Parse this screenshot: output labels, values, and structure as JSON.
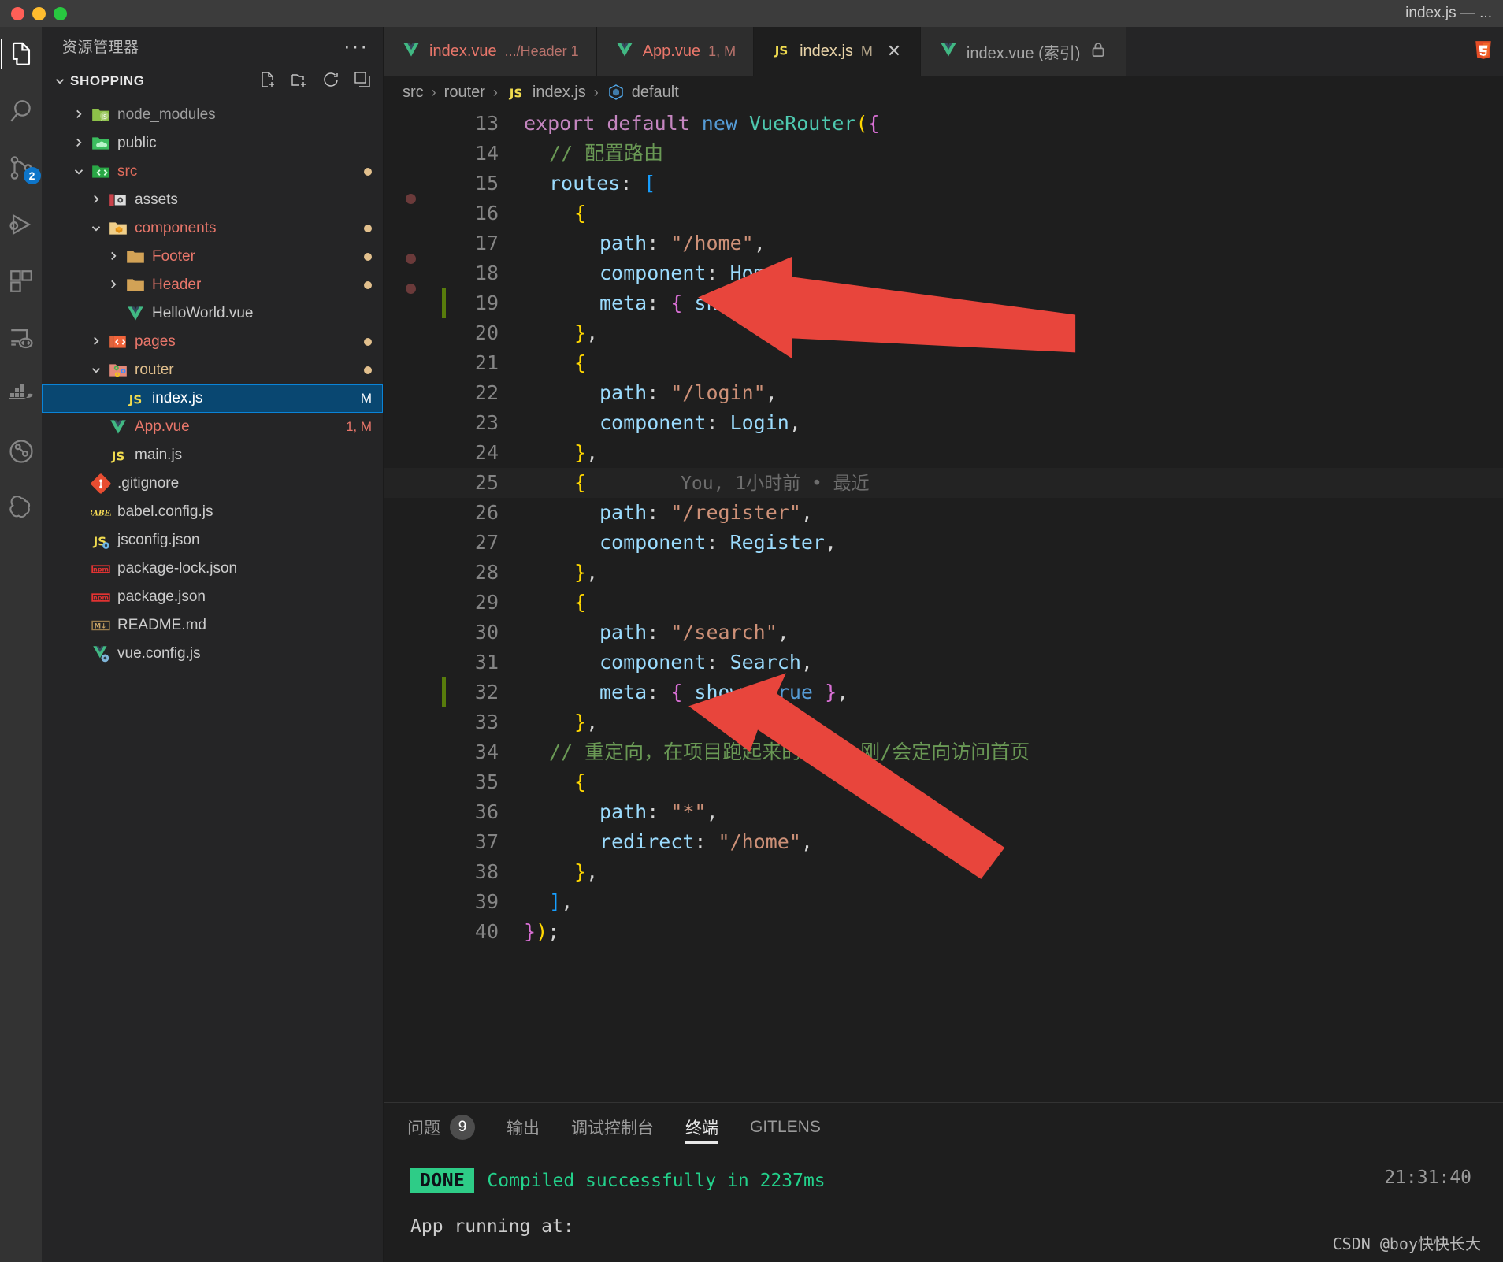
{
  "window": {
    "title": "index.js — ...",
    "traffic_lights": [
      "close",
      "minimize",
      "zoom"
    ]
  },
  "activitybar": {
    "items": [
      {
        "name": "explorer",
        "icon": "files-icon",
        "active": true,
        "badge": ""
      },
      {
        "name": "search",
        "icon": "search-icon",
        "active": false,
        "badge": ""
      },
      {
        "name": "source-control",
        "icon": "source-control-icon",
        "active": false,
        "badge": "2"
      },
      {
        "name": "run-and-debug",
        "icon": "run-debug-icon",
        "active": false,
        "badge": ""
      },
      {
        "name": "extensions",
        "icon": "extensions-icon",
        "active": false,
        "badge": ""
      },
      {
        "name": "remote-explorer",
        "icon": "remote-explorer-icon",
        "active": false,
        "badge": ""
      },
      {
        "name": "docker",
        "icon": "docker-icon",
        "active": false,
        "badge": ""
      },
      {
        "name": "gitlens",
        "icon": "gitlens-icon",
        "active": false,
        "badge": ""
      },
      {
        "name": "chatgpt",
        "icon": "chatgpt-icon",
        "active": false,
        "badge": ""
      }
    ]
  },
  "sidebar": {
    "title": "资源管理器",
    "more_label": "···",
    "section": {
      "name": "SHOPPING",
      "expanded": true,
      "actions": [
        "new-file",
        "new-folder",
        "refresh",
        "collapse-all"
      ]
    },
    "tree": [
      {
        "label": "node_modules",
        "icon": "folder-node",
        "indent": 1,
        "twisty": "collapsed",
        "color": "#a0a0a0",
        "meta": "",
        "dot": false,
        "selected": false
      },
      {
        "label": "public",
        "icon": "folder-public",
        "indent": 1,
        "twisty": "collapsed",
        "color": "#cccccc",
        "meta": "",
        "dot": false,
        "selected": false
      },
      {
        "label": "src",
        "icon": "folder-src",
        "indent": 1,
        "twisty": "expanded",
        "color": "#e06c5c",
        "meta": "",
        "dot": true,
        "selected": false
      },
      {
        "label": "assets",
        "icon": "folder-assets",
        "indent": 2,
        "twisty": "collapsed",
        "color": "#cccccc",
        "meta": "",
        "dot": false,
        "selected": false
      },
      {
        "label": "components",
        "icon": "folder-components",
        "indent": 2,
        "twisty": "expanded",
        "color": "#e8766a",
        "meta": "",
        "dot": true,
        "selected": false
      },
      {
        "label": "Footer",
        "icon": "folder-plain",
        "indent": 3,
        "twisty": "collapsed",
        "color": "#e8766a",
        "meta": "",
        "dot": true,
        "selected": false
      },
      {
        "label": "Header",
        "icon": "folder-plain",
        "indent": 3,
        "twisty": "collapsed",
        "color": "#e8766a",
        "meta": "",
        "dot": true,
        "selected": false
      },
      {
        "label": "HelloWorld.vue",
        "icon": "vue-icon",
        "indent": 3,
        "twisty": "none",
        "color": "#cccccc",
        "meta": "",
        "dot": false,
        "selected": false
      },
      {
        "label": "pages",
        "icon": "folder-pages",
        "indent": 2,
        "twisty": "collapsed",
        "color": "#e8766a",
        "meta": "",
        "dot": true,
        "selected": false
      },
      {
        "label": "router",
        "icon": "folder-router",
        "indent": 2,
        "twisty": "expanded",
        "color": "#e2c08d",
        "meta": "",
        "dot": true,
        "selected": false
      },
      {
        "label": "index.js",
        "icon": "js-icon",
        "indent": 3,
        "twisty": "none",
        "color": "#ffffff",
        "meta": "M",
        "dot": false,
        "selected": true
      },
      {
        "label": "App.vue",
        "icon": "vue-icon",
        "indent": 2,
        "twisty": "none",
        "color": "#e8766a",
        "meta": "1, M",
        "dot": false,
        "selected": false
      },
      {
        "label": "main.js",
        "icon": "js-icon",
        "indent": 2,
        "twisty": "none",
        "color": "#cccccc",
        "meta": "",
        "dot": false,
        "selected": false
      },
      {
        "label": ".gitignore",
        "icon": "git-icon",
        "indent": 1,
        "twisty": "none",
        "color": "#cccccc",
        "meta": "",
        "dot": false,
        "selected": false
      },
      {
        "label": "babel.config.js",
        "icon": "babel-icon",
        "indent": 1,
        "twisty": "none",
        "color": "#cccccc",
        "meta": "",
        "dot": false,
        "selected": false
      },
      {
        "label": "jsconfig.json",
        "icon": "jsconfig-icon",
        "indent": 1,
        "twisty": "none",
        "color": "#cccccc",
        "meta": "",
        "dot": false,
        "selected": false
      },
      {
        "label": "package-lock.json",
        "icon": "npm-icon",
        "indent": 1,
        "twisty": "none",
        "color": "#cccccc",
        "meta": "",
        "dot": false,
        "selected": false
      },
      {
        "label": "package.json",
        "icon": "npm-icon",
        "indent": 1,
        "twisty": "none",
        "color": "#cccccc",
        "meta": "",
        "dot": false,
        "selected": false
      },
      {
        "label": "README.md",
        "icon": "markdown-icon",
        "indent": 1,
        "twisty": "none",
        "color": "#cccccc",
        "meta": "",
        "dot": false,
        "selected": false
      },
      {
        "label": "vue.config.js",
        "icon": "vue-config-icon",
        "indent": 1,
        "twisty": "none",
        "color": "#cccccc",
        "meta": "",
        "dot": false,
        "selected": false
      }
    ]
  },
  "tabs": [
    {
      "label": "index.vue",
      "sub": ".../Header 1",
      "icon": "vue-icon",
      "active": false,
      "dirty": false,
      "close": false,
      "label_color": "#e8766a",
      "sub_color": "#b9736c"
    },
    {
      "label": "App.vue",
      "sub": "1, M",
      "icon": "vue-icon",
      "active": false,
      "dirty": false,
      "close": false,
      "label_color": "#e8766a",
      "sub_color": "#b9736c"
    },
    {
      "label": "index.js",
      "sub": "M",
      "icon": "js-icon",
      "active": true,
      "dirty": true,
      "close": true,
      "label_color": "#e8d3a8",
      "sub_color": "#b3a489"
    },
    {
      "label": "index.vue (索引)",
      "sub": "",
      "icon": "vue-icon",
      "active": false,
      "dirty": false,
      "close": false,
      "locked": true,
      "label_color": "#a8a8a8",
      "sub_color": "#8a8a8a"
    }
  ],
  "tabs_right_icons": [
    "html5-icon"
  ],
  "breadcrumb": [
    {
      "label": "src",
      "icon": ""
    },
    {
      "label": "router",
      "icon": ""
    },
    {
      "label": "index.js",
      "icon": "js-icon"
    },
    {
      "label": "default",
      "icon": "symbol-object-icon"
    }
  ],
  "editor": {
    "blame_annotation": "You, 1小时前 • 最近",
    "lines": [
      {
        "n": 13,
        "indent": 0,
        "modified": false,
        "breakpoint": false,
        "tokens": [
          {
            "t": "export",
            "c": "t-kw"
          },
          {
            "t": " ",
            "c": "t-plain"
          },
          {
            "t": "default",
            "c": "t-kw"
          },
          {
            "t": " ",
            "c": "t-plain"
          },
          {
            "t": "new",
            "c": "t-ctl"
          },
          {
            "t": " ",
            "c": "t-plain"
          },
          {
            "t": "VueRouter",
            "c": "t-fn"
          },
          {
            "t": "(",
            "c": "t-pn1"
          },
          {
            "t": "{",
            "c": "t-pn2"
          }
        ]
      },
      {
        "n": 14,
        "indent": 1,
        "modified": false,
        "breakpoint": false,
        "tokens": [
          {
            "t": "// 配置路由",
            "c": "t-cmt"
          }
        ]
      },
      {
        "n": 15,
        "indent": 1,
        "modified": false,
        "breakpoint": true,
        "tokens": [
          {
            "t": "routes",
            "c": "t-var"
          },
          {
            "t": ": ",
            "c": "t-plain"
          },
          {
            "t": "[",
            "c": "t-pn3"
          }
        ]
      },
      {
        "n": 16,
        "indent": 2,
        "modified": false,
        "breakpoint": false,
        "tokens": [
          {
            "t": "{",
            "c": "t-pn1"
          }
        ]
      },
      {
        "n": 17,
        "indent": 3,
        "modified": false,
        "breakpoint": true,
        "tokens": [
          {
            "t": "path",
            "c": "t-var"
          },
          {
            "t": ": ",
            "c": "t-plain"
          },
          {
            "t": "\"/home\"",
            "c": "t-str"
          },
          {
            "t": ",",
            "c": "t-plain"
          }
        ]
      },
      {
        "n": 18,
        "indent": 3,
        "modified": false,
        "breakpoint": true,
        "tokens": [
          {
            "t": "component",
            "c": "t-var"
          },
          {
            "t": ": ",
            "c": "t-plain"
          },
          {
            "t": "Home",
            "c": "t-var"
          },
          {
            "t": ",",
            "c": "t-plain"
          }
        ]
      },
      {
        "n": 19,
        "indent": 3,
        "modified": true,
        "breakpoint": false,
        "tokens": [
          {
            "t": "meta",
            "c": "t-var"
          },
          {
            "t": ": ",
            "c": "t-plain"
          },
          {
            "t": "{",
            "c": "t-pn2"
          },
          {
            "t": " ",
            "c": "t-plain"
          },
          {
            "t": "show",
            "c": "t-var"
          },
          {
            "t": ": ",
            "c": "t-plain"
          },
          {
            "t": "true",
            "c": "t-ctl"
          },
          {
            "t": " ",
            "c": "t-plain"
          },
          {
            "t": "}",
            "c": "t-pn2"
          },
          {
            "t": ",",
            "c": "t-plain"
          }
        ]
      },
      {
        "n": 20,
        "indent": 2,
        "modified": false,
        "breakpoint": false,
        "tokens": [
          {
            "t": "}",
            "c": "t-pn1"
          },
          {
            "t": ",",
            "c": "t-plain"
          }
        ]
      },
      {
        "n": 21,
        "indent": 2,
        "modified": false,
        "breakpoint": false,
        "tokens": [
          {
            "t": "{",
            "c": "t-pn1"
          }
        ]
      },
      {
        "n": 22,
        "indent": 3,
        "modified": false,
        "breakpoint": false,
        "tokens": [
          {
            "t": "path",
            "c": "t-var"
          },
          {
            "t": ": ",
            "c": "t-plain"
          },
          {
            "t": "\"/login\"",
            "c": "t-str"
          },
          {
            "t": ",",
            "c": "t-plain"
          }
        ]
      },
      {
        "n": 23,
        "indent": 3,
        "modified": false,
        "breakpoint": false,
        "tokens": [
          {
            "t": "component",
            "c": "t-var"
          },
          {
            "t": ": ",
            "c": "t-plain"
          },
          {
            "t": "Login",
            "c": "t-var"
          },
          {
            "t": ",",
            "c": "t-plain"
          }
        ]
      },
      {
        "n": 24,
        "indent": 2,
        "modified": false,
        "breakpoint": false,
        "tokens": [
          {
            "t": "}",
            "c": "t-pn1"
          },
          {
            "t": ",",
            "c": "t-plain"
          }
        ]
      },
      {
        "n": 25,
        "indent": 2,
        "modified": false,
        "breakpoint": false,
        "blame": true,
        "tokens": [
          {
            "t": "{",
            "c": "t-pn1"
          }
        ]
      },
      {
        "n": 26,
        "indent": 3,
        "modified": false,
        "breakpoint": false,
        "tokens": [
          {
            "t": "path",
            "c": "t-var"
          },
          {
            "t": ": ",
            "c": "t-plain"
          },
          {
            "t": "\"/register\"",
            "c": "t-str"
          },
          {
            "t": ",",
            "c": "t-plain"
          }
        ]
      },
      {
        "n": 27,
        "indent": 3,
        "modified": false,
        "breakpoint": false,
        "tokens": [
          {
            "t": "component",
            "c": "t-var"
          },
          {
            "t": ": ",
            "c": "t-plain"
          },
          {
            "t": "Register",
            "c": "t-var"
          },
          {
            "t": ",",
            "c": "t-plain"
          }
        ]
      },
      {
        "n": 28,
        "indent": 2,
        "modified": false,
        "breakpoint": false,
        "tokens": [
          {
            "t": "}",
            "c": "t-pn1"
          },
          {
            "t": ",",
            "c": "t-plain"
          }
        ]
      },
      {
        "n": 29,
        "indent": 2,
        "modified": false,
        "breakpoint": false,
        "tokens": [
          {
            "t": "{",
            "c": "t-pn1"
          }
        ]
      },
      {
        "n": 30,
        "indent": 3,
        "modified": false,
        "breakpoint": false,
        "tokens": [
          {
            "t": "path",
            "c": "t-var"
          },
          {
            "t": ": ",
            "c": "t-plain"
          },
          {
            "t": "\"/search\"",
            "c": "t-str"
          },
          {
            "t": ",",
            "c": "t-plain"
          }
        ]
      },
      {
        "n": 31,
        "indent": 3,
        "modified": false,
        "breakpoint": false,
        "tokens": [
          {
            "t": "component",
            "c": "t-var"
          },
          {
            "t": ": ",
            "c": "t-plain"
          },
          {
            "t": "Search",
            "c": "t-var"
          },
          {
            "t": ",",
            "c": "t-plain"
          }
        ]
      },
      {
        "n": 32,
        "indent": 3,
        "modified": true,
        "breakpoint": false,
        "tokens": [
          {
            "t": "meta",
            "c": "t-var"
          },
          {
            "t": ": ",
            "c": "t-plain"
          },
          {
            "t": "{",
            "c": "t-pn2"
          },
          {
            "t": " ",
            "c": "t-plain"
          },
          {
            "t": "show",
            "c": "t-var"
          },
          {
            "t": ": ",
            "c": "t-plain"
          },
          {
            "t": "true",
            "c": "t-ctl"
          },
          {
            "t": " ",
            "c": "t-plain"
          },
          {
            "t": "}",
            "c": "t-pn2"
          },
          {
            "t": ",",
            "c": "t-plain"
          }
        ]
      },
      {
        "n": 33,
        "indent": 2,
        "modified": false,
        "breakpoint": false,
        "tokens": [
          {
            "t": "}",
            "c": "t-pn1"
          },
          {
            "t": ",",
            "c": "t-plain"
          }
        ]
      },
      {
        "n": 34,
        "indent": 1,
        "modified": false,
        "breakpoint": false,
        "tokens": [
          {
            "t": "// 重定向，在项目跑起来的时候，刚/会定向访问首页",
            "c": "t-cmt"
          }
        ]
      },
      {
        "n": 35,
        "indent": 2,
        "modified": false,
        "breakpoint": false,
        "tokens": [
          {
            "t": "{",
            "c": "t-pn1"
          }
        ]
      },
      {
        "n": 36,
        "indent": 3,
        "modified": false,
        "breakpoint": false,
        "tokens": [
          {
            "t": "path",
            "c": "t-var"
          },
          {
            "t": ": ",
            "c": "t-plain"
          },
          {
            "t": "\"*\"",
            "c": "t-str"
          },
          {
            "t": ",",
            "c": "t-plain"
          }
        ]
      },
      {
        "n": 37,
        "indent": 3,
        "modified": false,
        "breakpoint": false,
        "tokens": [
          {
            "t": "redirect",
            "c": "t-var"
          },
          {
            "t": ": ",
            "c": "t-plain"
          },
          {
            "t": "\"/home\"",
            "c": "t-str"
          },
          {
            "t": ",",
            "c": "t-plain"
          }
        ]
      },
      {
        "n": 38,
        "indent": 2,
        "modified": false,
        "breakpoint": false,
        "tokens": [
          {
            "t": "}",
            "c": "t-pn1"
          },
          {
            "t": ",",
            "c": "t-plain"
          }
        ]
      },
      {
        "n": 39,
        "indent": 1,
        "modified": false,
        "breakpoint": false,
        "tokens": [
          {
            "t": "]",
            "c": "t-pn3"
          },
          {
            "t": ",",
            "c": "t-plain"
          }
        ]
      },
      {
        "n": 40,
        "indent": 0,
        "modified": false,
        "breakpoint": false,
        "tokens": [
          {
            "t": "}",
            "c": "t-pn2"
          },
          {
            "t": ")",
            "c": "t-pn1"
          },
          {
            "t": ";",
            "c": "t-plain"
          }
        ]
      }
    ]
  },
  "panel": {
    "tabs": [
      {
        "label": "问题",
        "badge": "9",
        "active": false
      },
      {
        "label": "输出",
        "badge": "",
        "active": false
      },
      {
        "label": "调试控制台",
        "badge": "",
        "active": false
      },
      {
        "label": "终端",
        "badge": "",
        "active": true
      },
      {
        "label": "GITLENS",
        "badge": "",
        "active": false
      }
    ],
    "terminal": {
      "status_badge": "DONE",
      "message": "Compiled successfully in 2237ms",
      "timestamp": "21:31:40",
      "next_line": "App running at:"
    }
  },
  "watermark": "CSDN @boy快快长大",
  "annotations": {
    "arrow_color": "#e8453c",
    "arrow_count": 2
  }
}
